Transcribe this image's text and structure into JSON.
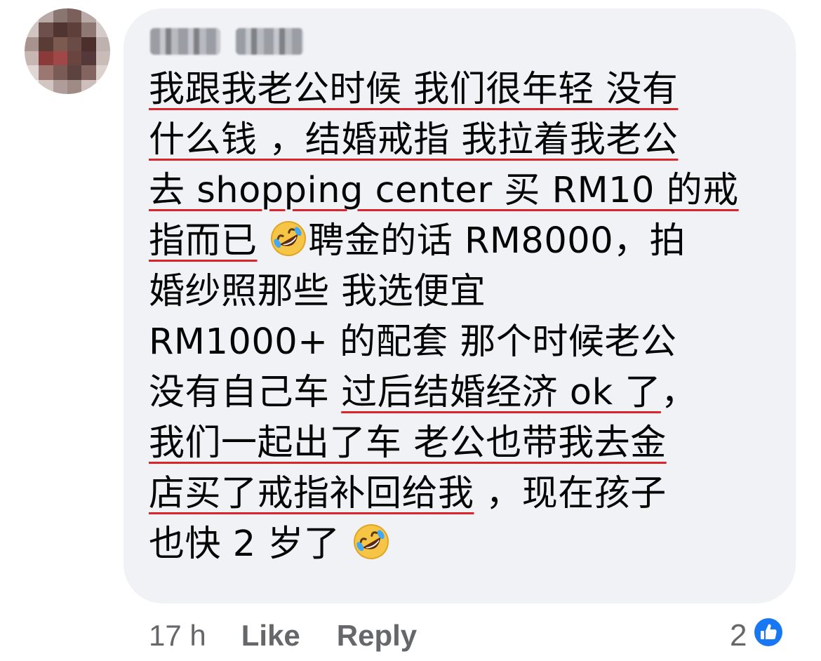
{
  "comment": {
    "author_name": "Kelly Ong",
    "lines": [
      [
        {
          "t": "我跟我老公时候 我们很年轻 没有",
          "ul": true
        }
      ],
      [
        {
          "t": "什么钱 ，结婚戒指 我拉着我老公",
          "ul": true
        }
      ],
      [
        {
          "t": "去 shopping center 买 RM10 的戒",
          "ul": true
        }
      ],
      [
        {
          "t": "指而已",
          "ul": true
        },
        {
          "t": " "
        },
        {
          "emoji": "rofl"
        },
        {
          "t": "聘金的话 RM8000，拍"
        }
      ],
      [
        {
          "t": "婚纱照那些 我选便宜"
        }
      ],
      [
        {
          "t": "RM1000+ 的配套  那个时候老公"
        }
      ],
      [
        {
          "t": "没有自己车 "
        },
        {
          "t": "过后结婚经济 ok 了",
          "ul": true
        },
        {
          "t": "，"
        }
      ],
      [
        {
          "t": "我们一起出了车 老公也带我去金",
          "ul": true
        }
      ],
      [
        {
          "t": "店买了戒指补回给我",
          "ul": true
        },
        {
          "t": " ，现在孩子"
        }
      ],
      [
        {
          "t": "也快 2 岁了 "
        },
        {
          "emoji": "rofl"
        }
      ]
    ]
  },
  "footer": {
    "time": "17 h",
    "like_label": "Like",
    "reply_label": "Reply"
  },
  "reactions": {
    "count": "2",
    "icon": "thumbs-up-icon",
    "color": "#1877f2"
  },
  "colors": {
    "bubble": "#f0f2f5",
    "text": "#050505",
    "meta": "#65676b",
    "underline": "#d8262c"
  }
}
